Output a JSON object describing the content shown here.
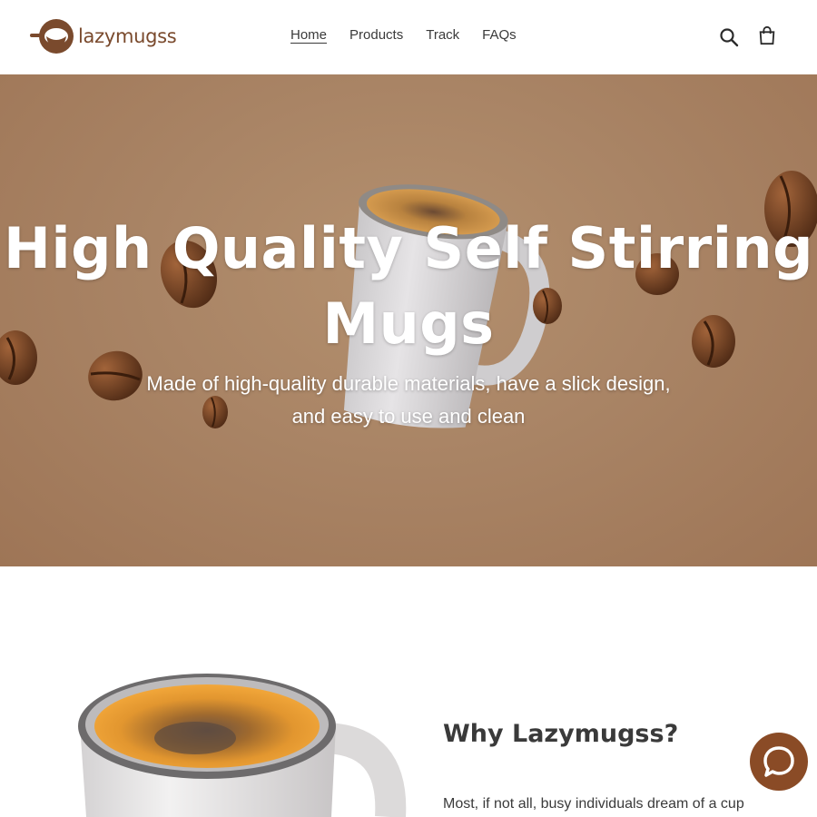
{
  "header": {
    "logo_text": "lazymugss",
    "nav": [
      {
        "label": "Home",
        "active": true
      },
      {
        "label": "Products",
        "active": false
      },
      {
        "label": "Track",
        "active": false
      },
      {
        "label": "FAQs",
        "active": false
      }
    ],
    "icons": [
      "search-icon",
      "cart-icon"
    ]
  },
  "hero": {
    "title": "High Quality Self Stirring Mugs",
    "subtitle": "Made of high-quality durable materials, have a slick design, and easy to use and clean"
  },
  "feature": {
    "heading": "Why Lazymugss?",
    "text": "Most, if not all, busy individuals dream of a cup"
  },
  "chat": {
    "icon": "chat-icon"
  },
  "colors": {
    "brand_brown": "#7a4a2d",
    "hero_background": "#a98465",
    "chat_button": "#8a4b26"
  }
}
